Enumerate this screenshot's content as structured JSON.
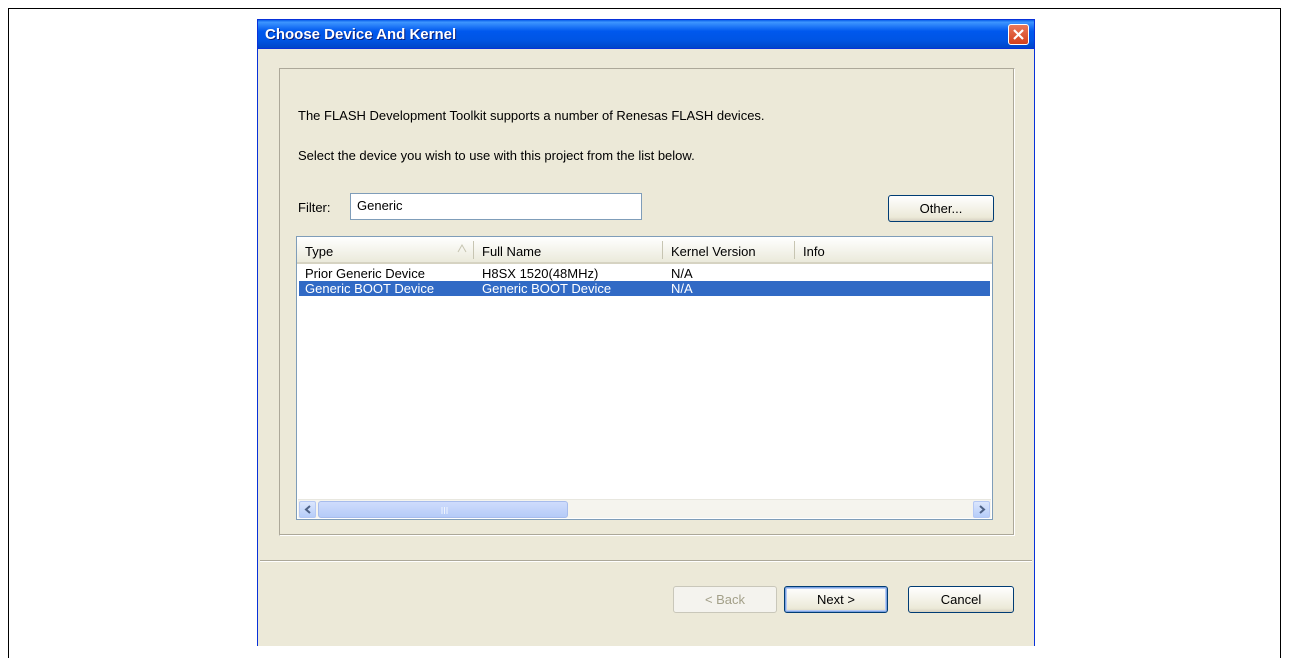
{
  "window": {
    "title": "Choose Device And Kernel"
  },
  "intro": {
    "line1": "The FLASH Development Toolkit supports a number of Renesas FLASH devices.",
    "line2": "Select the device you wish to use with this project from the list below."
  },
  "filter": {
    "label": "Filter:",
    "value": "Generic"
  },
  "other_button": "Other...",
  "list": {
    "columns": [
      "Type",
      "Full Name",
      "Kernel Version",
      "Info"
    ],
    "sort_column": "Type",
    "rows": [
      {
        "type": "Prior Generic Device",
        "full_name": "H8SX 1520(48MHz)",
        "kernel_version": "N/A",
        "info": "",
        "selected": false
      },
      {
        "type": "Generic BOOT Device",
        "full_name": "Generic BOOT Device",
        "kernel_version": "N/A",
        "info": "",
        "selected": true
      }
    ]
  },
  "buttons": {
    "back": "< Back",
    "next": "Next >",
    "cancel": "Cancel"
  },
  "colors": {
    "titlebar": "#0058ee",
    "selection": "#316ac5",
    "dialog_bg": "#ece9d8"
  }
}
